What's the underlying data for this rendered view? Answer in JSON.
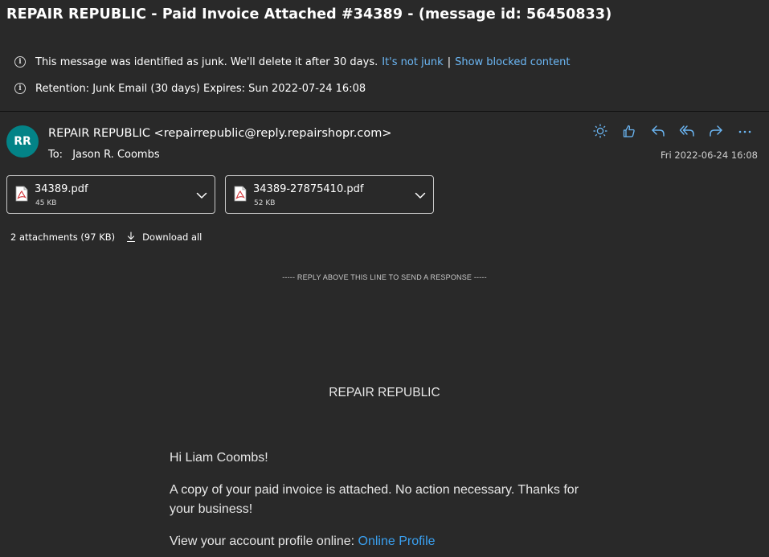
{
  "subject": "REPAIR REPUBLIC - Paid Invoice Attached #34389 - (message id: 56450833)",
  "junk_notice": {
    "text": "This message was identified as junk. We'll delete it after 30 days.",
    "not_junk_link": "It's not junk",
    "separator": "|",
    "show_blocked_link": "Show blocked content",
    "icon": "info-icon"
  },
  "retention_notice": {
    "text": "Retention: Junk Email (30 days) Expires: Sun 2022-07-24 16:08",
    "icon": "info-icon"
  },
  "sender": {
    "initials": "RR",
    "avatar_color": "#038387",
    "display": "REPAIR REPUBLIC <repairrepublic@reply.repairshopr.com>",
    "to_label": "To:",
    "to_name": "Jason R. Coombs",
    "date": "Fri 2022-06-24 16:08"
  },
  "toolbar": {
    "icons": [
      "sun-icon",
      "like-icon",
      "reply-icon",
      "reply-all-icon",
      "forward-icon",
      "more-icon"
    ]
  },
  "attachments": [
    {
      "name": "34389.pdf",
      "size": "45 KB",
      "icon": "pdf-file-icon"
    },
    {
      "name": "34389-27875410.pdf",
      "size": "52 KB",
      "icon": "pdf-file-icon"
    }
  ],
  "attachments_summary": "2 attachments (97 KB)",
  "download_all": "Download all",
  "email_body": {
    "reply_line": "----- REPLY ABOVE THIS LINE TO SEND A RESPONSE -----",
    "shop_name": "REPAIR REPUBLIC",
    "greeting": "Hi Liam Coombs!",
    "paragraph": "A copy of your paid invoice is attached. No action necessary. Thanks for your business!",
    "profile_prefix": "View your account profile online:",
    "profile_link": "Online Profile"
  },
  "colors": {
    "background": "#292929",
    "link": "#6cb8f6",
    "accent_icons": "#6cb8f6"
  }
}
